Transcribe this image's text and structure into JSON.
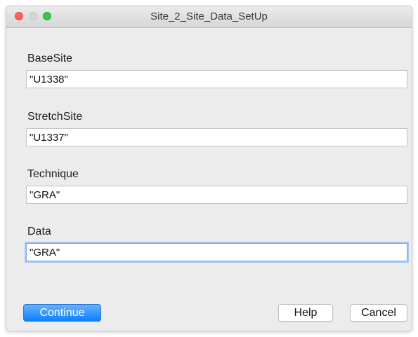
{
  "window": {
    "title": "Site_2_Site_Data_SetUp"
  },
  "fields": [
    {
      "label": "BaseSite",
      "value": "\"U1338\""
    },
    {
      "label": "StretchSite",
      "value": "\"U1337\""
    },
    {
      "label": "Technique",
      "value": "\"GRA\""
    },
    {
      "label": "Data",
      "value": "\"GRA\""
    }
  ],
  "buttons": {
    "continue_label": "Continue",
    "help_label": "Help",
    "cancel_label": "Cancel"
  },
  "colors": {
    "primary_button": "#0d81ff",
    "focus_ring": "#a7c7f5",
    "close_light": "#fc605c",
    "zoom_light": "#34c84a"
  }
}
